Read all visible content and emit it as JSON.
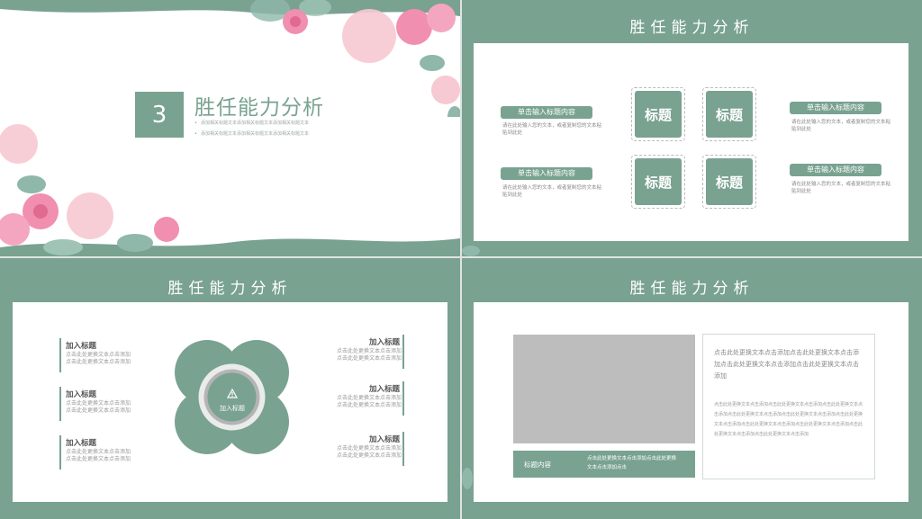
{
  "slide1": {
    "number": "3",
    "title": "胜任能力分析",
    "sub1": "添加相关标题文本添加相关标题文本添加相关标题文本",
    "sub2": "添加相关标题文本添加相关标题文本添加相关标题文本"
  },
  "slide2": {
    "header": "胜任能力分析",
    "pill_label": "单击输入标题内容",
    "desc": "请在此处输入您的文本，或者复制您的文本粘贴到此处",
    "tile_label": "标题"
  },
  "slide3": {
    "header": "胜任能力分析",
    "center_label": "加入标题",
    "item_title": "加入标题",
    "item_desc": "点击此处更换文本点击添加点击此处更换文本点击添加"
  },
  "slide4": {
    "header": "胜任能力分析",
    "bar_label": "标题内容",
    "bar_text": "点击此处更换文本点击添加点击此处更换文本点击添加点击",
    "main_text": "点击此处更换文本点击添加点击此处更换文本点击添加点击此处更换文本点击添加点击此处更换文本点击添加",
    "small_text": "点击此处更换文本点击添加点击此处更换文本点击添加点击此处更换文本点击添加点击此处更换文本点击添加点击此处更换文本点击添加点击此处更换文本点击添加点击此处更换文本点击添加点击此处更换文本点击添加点击此处更换文本点击添加点击此处更换文本点击添加"
  },
  "colors": {
    "accent": "#79a291",
    "pink": "#f08fb0",
    "leaf": "#8fb8aa"
  }
}
